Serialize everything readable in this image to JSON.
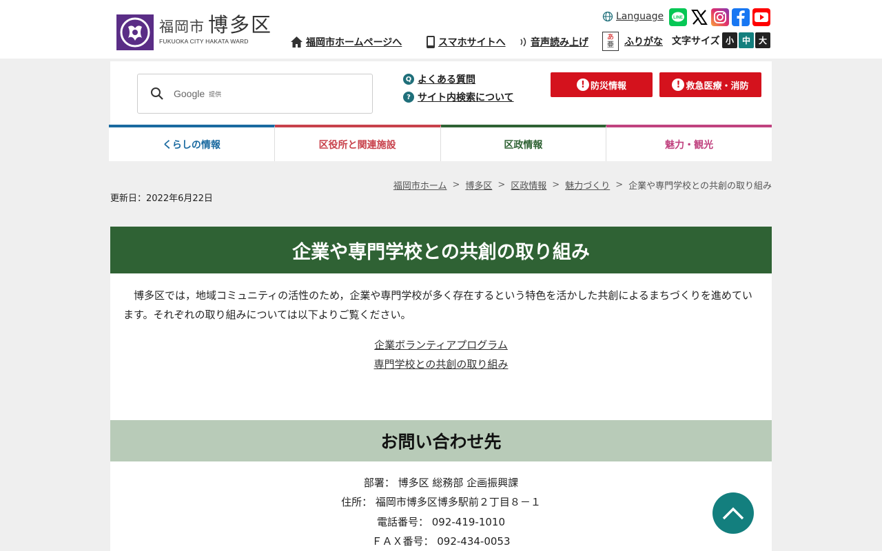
{
  "header": {
    "logo": {
      "city": "福岡市",
      "ward": "博多区",
      "en": "FUKUOKA CITY HAKATA WARD"
    },
    "language": "Language",
    "links": {
      "home": "福岡市ホームページへ",
      "smartphone": "スマホサイトへ",
      "speech": "音声読み上げ",
      "furigana": "ふりがな"
    },
    "furigana_icon": {
      "top": "あ",
      "bottom": "亜"
    },
    "font_size": {
      "label": "文字サイズ",
      "small": "小",
      "medium": "中",
      "large": "大"
    },
    "social": [
      "line-icon",
      "x-icon",
      "instagram-icon",
      "facebook-icon",
      "youtube-icon"
    ],
    "social_labels": {
      "line": "LINE"
    }
  },
  "search": {
    "brand": "Google",
    "provided": "提供"
  },
  "quick_links": {
    "faq": "よくある質問",
    "search_help": "サイト内検索について"
  },
  "faq_icon": "Q",
  "help_icon": "?",
  "emergency": {
    "disaster": "防災情報",
    "ambulance": "救急医療・消防"
  },
  "nav": [
    {
      "label": "くらしの情報",
      "color": "#1a6aa0"
    },
    {
      "label": "区役所と関連施設",
      "color": "#c8414b"
    },
    {
      "label": "区政情報",
      "color": "#2f6234"
    },
    {
      "label": "魅力・観光",
      "color": "#c0427f"
    }
  ],
  "breadcrumb": [
    "福岡市ホーム",
    "博多区",
    "区政情報",
    "魅力づくり",
    "企業や専門学校との共創の取り組み"
  ],
  "breadcrumb_sep": ">",
  "updated": "更新日：2022年6月22日",
  "page_title": "企業や専門学校との共創の取り組み",
  "body": "博多区では，地域コミュニティの活性のため，企業や専門学校が多く存在するという特色を活かした共創によるまちづくりを進めています。それぞれの取り組みについては以下よりご覧ください。",
  "content_links": [
    "企業ボランティアプログラム",
    "専門学校との共創の取り組み"
  ],
  "contact": {
    "heading": "お問い合わせ先",
    "department": "部署： 博多区 総務部 企画振興課",
    "address": "住所： 福岡市博多区博多駅前２丁目８－１",
    "phone": "電話番号： 092-419-1010",
    "fax": "ＦＡＸ番号： 092-434-0053"
  },
  "colors": {
    "title_bar": "#2f6234",
    "emergency": "#d4121d",
    "accent": "#137f7e"
  }
}
